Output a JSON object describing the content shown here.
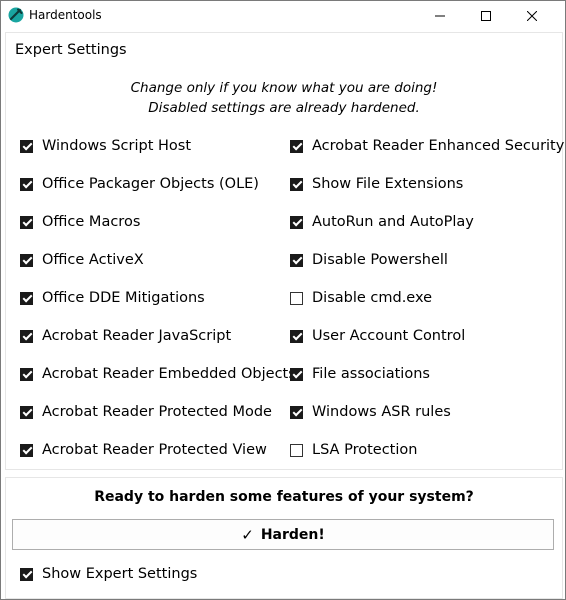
{
  "window": {
    "title": "Hardentools"
  },
  "expert": {
    "heading": "Expert Settings",
    "note_line1": "Change only if you know what you are doing!",
    "note_line2": "Disabled settings are already hardened."
  },
  "settings_left": [
    {
      "label": "Windows Script Host",
      "checked": true
    },
    {
      "label": "Office Packager Objects (OLE)",
      "checked": true
    },
    {
      "label": "Office Macros",
      "checked": true
    },
    {
      "label": "Office ActiveX",
      "checked": true
    },
    {
      "label": "Office DDE Mitigations",
      "checked": true
    },
    {
      "label": "Acrobat Reader JavaScript",
      "checked": true
    },
    {
      "label": "Acrobat Reader Embedded Objects",
      "checked": true
    },
    {
      "label": "Acrobat Reader Protected Mode",
      "checked": true
    },
    {
      "label": "Acrobat Reader Protected View",
      "checked": true
    }
  ],
  "settings_right": [
    {
      "label": "Acrobat Reader Enhanced Security",
      "checked": true
    },
    {
      "label": "Show File Extensions",
      "checked": true
    },
    {
      "label": "AutoRun and AutoPlay",
      "checked": true
    },
    {
      "label": "Disable Powershell",
      "checked": true
    },
    {
      "label": "Disable cmd.exe",
      "checked": false
    },
    {
      "label": "User Account Control",
      "checked": true
    },
    {
      "label": "File associations",
      "checked": true
    },
    {
      "label": "Windows ASR rules",
      "checked": true
    },
    {
      "label": "LSA Protection",
      "checked": false
    }
  ],
  "footer": {
    "ready_text": "Ready to harden some features of your system?",
    "harden_label": "Harden!",
    "show_expert_label": "Show Expert Settings",
    "show_expert_checked": true
  },
  "colors": {
    "checkbox_fill": "#1a1a1a",
    "icon_teal": "#19a5a0"
  },
  "icons": {
    "app": "hardentools-logo-icon",
    "harden": "checkmark-icon"
  }
}
